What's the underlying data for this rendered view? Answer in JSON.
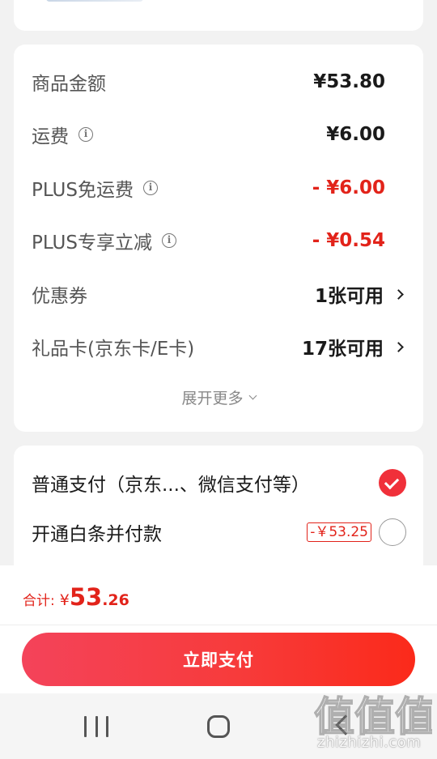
{
  "price_summary": {
    "rows": [
      {
        "label": "商品金额",
        "value": "¥53.80"
      },
      {
        "label": "运费",
        "value": "¥6.00"
      },
      {
        "label": "PLUS免运费",
        "value": "- ¥6.00"
      },
      {
        "label": "PLUS专享立减",
        "value": "- ¥0.54"
      },
      {
        "label": "优惠券",
        "value": "1张可用"
      },
      {
        "label": "礼品卡(京东卡/E卡)",
        "value": "17张可用"
      }
    ],
    "expand_label": "展开更多"
  },
  "payment": {
    "options": [
      {
        "label": "普通支付（京东...、微信支付等）",
        "selected": true
      },
      {
        "label": "开通白条并付款",
        "tag": "-￥53.25",
        "selected": false
      }
    ]
  },
  "bottom": {
    "total_label": "合计:",
    "currency": "¥",
    "total_int": "53",
    "total_dec": ".26",
    "pay_button": "立即支付"
  },
  "watermark": {
    "text": "zhizhizhi.com",
    "logo_text": "值值值"
  },
  "colors": {
    "accent": "#e2231a",
    "button_gradient_start": "#f4435a",
    "button_gradient_end": "#fb2a1a"
  },
  "icons": [
    "info-icon",
    "chevron-right-icon",
    "chevron-down-icon",
    "check-icon",
    "recents-icon",
    "home-icon",
    "back-icon"
  ]
}
